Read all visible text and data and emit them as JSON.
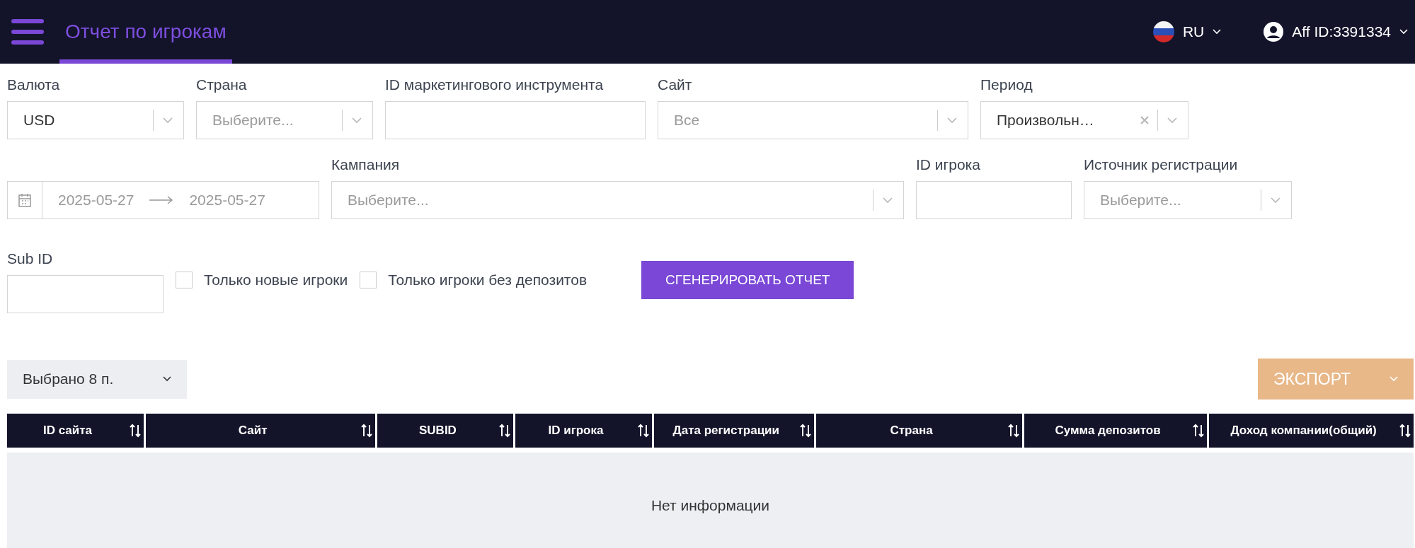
{
  "header": {
    "title": "Отчет по игрокам",
    "language": "RU",
    "account": "Aff ID:3391334"
  },
  "filter_rows": [
    [
      {
        "kind": "select",
        "label": "Валюта",
        "value": "USD",
        "clearable": false
      },
      {
        "kind": "select",
        "label": "Страна",
        "placeholder": "Выберите...",
        "clearable": false
      },
      {
        "kind": "input",
        "label": "ID маркетингового инструмента"
      },
      {
        "kind": "select",
        "label": "Сайт",
        "placeholder": "Все",
        "clearable": false
      },
      {
        "kind": "select",
        "label": "Период",
        "value": "Произвольн…",
        "clearable": true
      }
    ],
    [
      {
        "kind": "date_range",
        "start": "2025-05-27",
        "end": "2025-05-27"
      },
      {
        "kind": "select",
        "label": "Кампания",
        "placeholder": "Выберите...",
        "clearable": false
      },
      {
        "kind": "input",
        "label": "ID игрока"
      },
      {
        "kind": "select",
        "label": "Источник регистрации",
        "placeholder": "Выберите...",
        "clearable": false
      }
    ],
    [
      {
        "kind": "input",
        "label": "Sub ID"
      },
      {
        "kind": "checkbox",
        "label": "Только новые игроки",
        "checked": false
      },
      {
        "kind": "checkbox",
        "label": "Только игроки без депозитов",
        "checked": false
      },
      {
        "kind": "button",
        "label": "СГЕНЕРИРОВАТЬ ОТЧЕТ"
      }
    ]
  ],
  "columns_picker": "Выбрано 8 п.",
  "export_button": "ЭКСПОРТ",
  "table": {
    "columns": [
      "ID сайта",
      "Сайт",
      "SUBID",
      "ID игрока",
      "Дата регистрации",
      "Страна",
      "Сумма депозитов",
      "Доход компании(общий)"
    ],
    "empty_text": "Нет информации"
  }
}
